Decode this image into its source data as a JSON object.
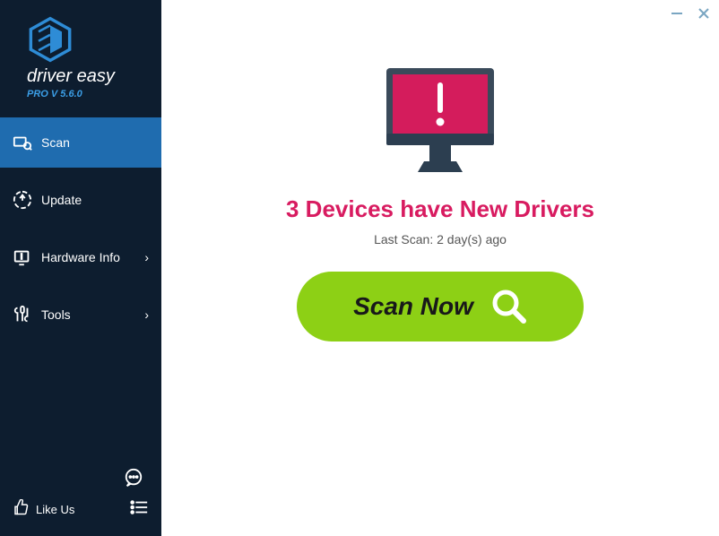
{
  "brand": {
    "name": "driver easy",
    "sub": "PRO V 5.6.0"
  },
  "nav": [
    {
      "label": "Scan",
      "active": true
    },
    {
      "label": "Update",
      "active": false
    },
    {
      "label": "Hardware Info",
      "active": false,
      "chevron": "›"
    },
    {
      "label": "Tools",
      "active": false,
      "chevron": "›"
    }
  ],
  "likeus": "Like Us",
  "main": {
    "headline": "3 Devices have New Drivers",
    "subline": "Last Scan: 2 day(s) ago",
    "scan_button": "Scan Now"
  },
  "colors": {
    "sidebar_bg": "#0d1d2f",
    "sidebar_active": "#1f6caf",
    "brand_accent": "#3b9ee6",
    "cta_green": "#8dd015",
    "headline_pink": "#d81b60",
    "monitor_screen": "#d41c5c",
    "monitor_frame": "#2c3e50"
  }
}
